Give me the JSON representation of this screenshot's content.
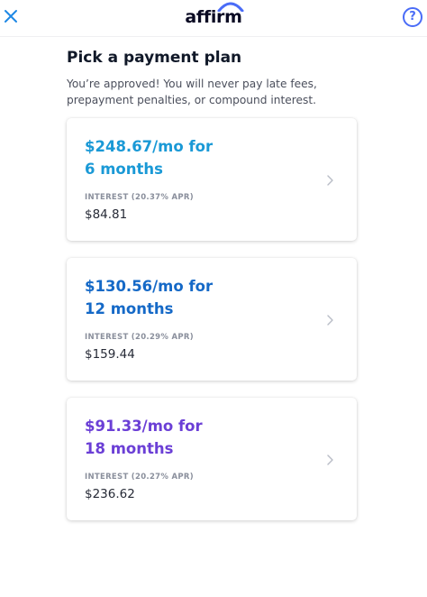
{
  "header": {
    "logo_text": "affirm",
    "help_label": "?"
  },
  "main": {
    "title": "Pick a payment plan",
    "subtitle": "You’re approved! You will never pay late fees, prepayment penalties, or compound interest."
  },
  "plans": [
    {
      "amount": "$248.67",
      "per": "/mo for",
      "term": "6 months",
      "interest_label": "INTEREST (20.37% APR)",
      "interest_amount": "$84.81",
      "color": "#1a99d6"
    },
    {
      "amount": "$130.56",
      "per": "/mo for",
      "term": "12 months",
      "interest_label": "INTEREST (20.29% APR)",
      "interest_amount": "$159.44",
      "color": "#1569c7"
    },
    {
      "amount": "$91.33",
      "per": "/mo for",
      "term": "18 months",
      "interest_label": "INTEREST (20.27% APR)",
      "interest_amount": "$236.62",
      "color": "#6b3fd6"
    }
  ],
  "colors": {
    "accent": "#4a6cf7",
    "close": "#1e88e5"
  },
  "icons": [
    "close-icon",
    "help-icon",
    "chevron-right-icon"
  ]
}
